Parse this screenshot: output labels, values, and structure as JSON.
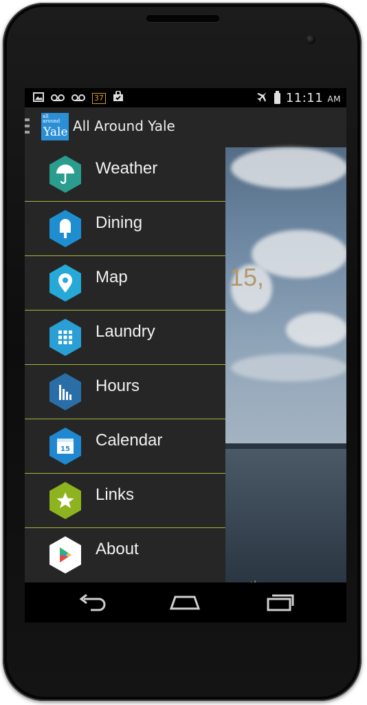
{
  "statusbar": {
    "badge": "37",
    "time": "11:11",
    "ampm": "AM"
  },
  "app": {
    "title": "All Around Yale",
    "logo": {
      "line1": "all",
      "line2": "around",
      "line3": "Yale"
    }
  },
  "background": {
    "date_fragment": "15,",
    "hint_fragment": "pen the menu"
  },
  "menu": {
    "items": [
      {
        "label": "Weather",
        "icon": "umbrella-icon",
        "color": "#2a9d8f"
      },
      {
        "label": "Dining",
        "icon": "popsicle-icon",
        "color": "#1f8ed1"
      },
      {
        "label": "Map",
        "icon": "map-pin-icon",
        "color": "#27a9d8"
      },
      {
        "label": "Laundry",
        "icon": "grid-icon",
        "color": "#2a9fd6"
      },
      {
        "label": "Hours",
        "icon": "bars-icon",
        "color": "#2a6ea8"
      },
      {
        "label": "Calendar",
        "icon": "calendar-icon",
        "color": "#1f88d0",
        "calendar_day": "15"
      },
      {
        "label": "Links",
        "icon": "star-icon",
        "color": "#8db31e"
      },
      {
        "label": "About",
        "icon": "play-store-icon",
        "color": "#ffffff"
      }
    ]
  },
  "colors": {
    "divider": "#a9b43a",
    "drawer_bg": "#262626",
    "actionbar_bg": "#262626"
  }
}
